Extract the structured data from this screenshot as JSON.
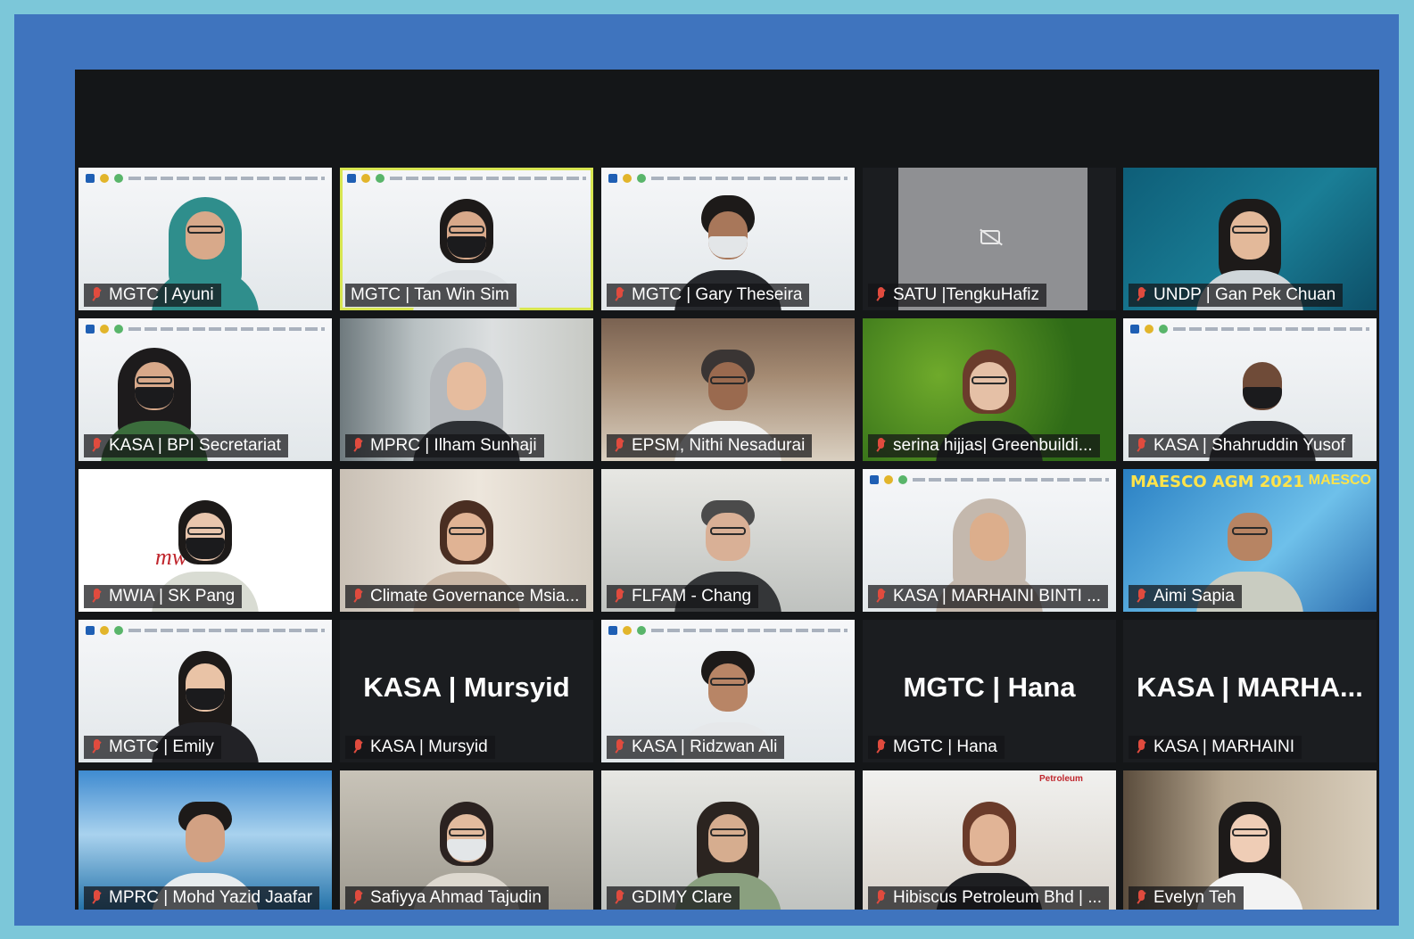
{
  "meeting": {
    "participants": [
      {
        "id": "t1",
        "name": "MGTC | Ayuni"
      },
      {
        "id": "t2",
        "name": "MGTC | Tan Win Sim"
      },
      {
        "id": "t3",
        "name": "MGTC | Gary Theseira"
      },
      {
        "id": "t4",
        "name": "SATU |TengkuHafiz"
      },
      {
        "id": "t5",
        "name": "UNDP | Gan Pek Chuan"
      },
      {
        "id": "t6",
        "name": "KASA | BPI Secretariat"
      },
      {
        "id": "t7",
        "name": "MPRC | Ilham Sunhaji"
      },
      {
        "id": "t8",
        "name": "EPSM, Nithi Nesadurai"
      },
      {
        "id": "t9",
        "name": "serina hijjas| Greenbuildi..."
      },
      {
        "id": "t10",
        "name": "KASA | Shahruddin Yusof"
      },
      {
        "id": "t11",
        "name": "MWIA | SK Pang"
      },
      {
        "id": "t12",
        "name": "Climate Governance Msia..."
      },
      {
        "id": "t13",
        "name": "FLFAM - Chang"
      },
      {
        "id": "t14",
        "name": "KASA | MARHAINI BINTI ..."
      },
      {
        "id": "t15",
        "name": "Aimi Sapia"
      },
      {
        "id": "t16",
        "name": "MGTC | Emily"
      },
      {
        "id": "t17",
        "name": "KASA | Mursyid",
        "display": "KASA | Mursyid"
      },
      {
        "id": "t18",
        "name": "KASA | Ridzwan Ali"
      },
      {
        "id": "t19",
        "name": "MGTC | Hana",
        "display": "MGTC | Hana"
      },
      {
        "id": "t20",
        "name": "KASA | MARHAINI",
        "display": "KASA | MARHA..."
      },
      {
        "id": "t21",
        "name": "MPRC | Mohd Yazid Jaafar"
      },
      {
        "id": "t22",
        "name": "Safiyya Ahmad Tajudin"
      },
      {
        "id": "t23",
        "name": "GDIMY Clare"
      },
      {
        "id": "t24",
        "name": "Hibiscus Petroleum Bhd | ..."
      },
      {
        "id": "t25",
        "name": "Evelyn Teh"
      }
    ],
    "backgrounds": {
      "poster_title": "MAESCO AGM 2021",
      "poster_tag": "MAESCO",
      "mwia_logo": "mw",
      "petro_tag": "Petroleum"
    }
  },
  "colors": {
    "outer_bg": "#7cc7d9",
    "frame_bg": "#3f74be",
    "window_bg": "#141618",
    "active_speaker": "#d8e651",
    "muted_mic": "#e04b3e"
  },
  "icons": {
    "muted": "mic-muted-icon",
    "camera_off": "camera-off-icon"
  }
}
